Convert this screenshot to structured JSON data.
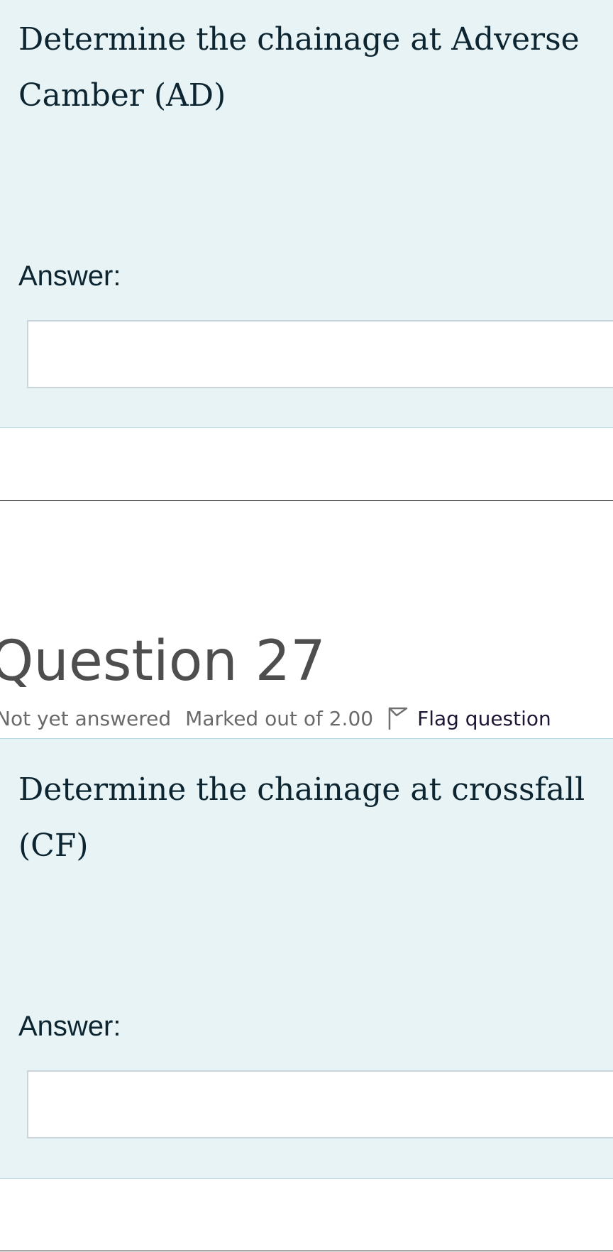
{
  "q26": {
    "question_text": "Determine the chainage at Adverse Camber (AD)",
    "answer_label": "Answer:",
    "answer_value": ""
  },
  "q27": {
    "heading": "Question 27",
    "state": "Not yet answered",
    "grade": "Marked out of 2.00",
    "flag_label": "Flag question",
    "question_text": "Determine the chainage at crossfall (CF)",
    "answer_label": "Answer:",
    "answer_value": ""
  },
  "icons": {
    "flag": "flag-outline-icon"
  },
  "colors": {
    "panel_bg": "#e7f3f5",
    "panel_border": "#b8dce2",
    "question_text": "#0c2530",
    "heading": "#4e4e4e",
    "info_text": "#6a6a6a",
    "flag_link": "#1f1534"
  }
}
